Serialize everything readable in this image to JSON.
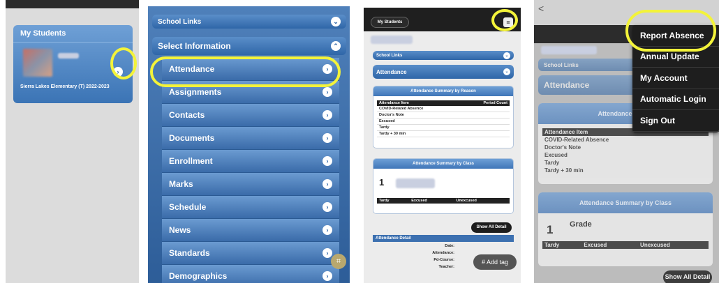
{
  "panel1": {
    "card_title": "My Students",
    "school": "Sierra Lakes Elementary (T) 2022-2023"
  },
  "panel2": {
    "school_links": "School Links",
    "select_information": "Select Information",
    "menu": [
      "Attendance",
      "Assignments",
      "Contacts",
      "Documents",
      "Enrollment",
      "Marks",
      "Schedule",
      "News",
      "Standards",
      "Demographics"
    ]
  },
  "panel3": {
    "my_students": "My Students",
    "school_links": "School Links",
    "attendance": "Attendance",
    "summary_by_reason": {
      "title": "Attendance Summary by Reason",
      "headers": [
        "Attendance Item",
        "Period Count"
      ],
      "rows": [
        "COVID-Related Absence",
        "Doctor's Note",
        "Excused",
        "Tardy",
        "Tardy + 30 min"
      ]
    },
    "summary_by_class": {
      "title": "Attendance Summary by Class",
      "period": "1",
      "headers": [
        "Tardy",
        "Excused",
        "Unexcused"
      ]
    },
    "show_all_detail": "Show All Detail",
    "attendance_detail": "Attendance Detail",
    "detail_labels": [
      "Date:",
      "Attendance:",
      "Pd-Course:",
      "Teacher:"
    ],
    "add_tag": "# Add tag"
  },
  "panel4": {
    "back_glyph": "<",
    "school_links": "School Links",
    "attendance": "Attendance",
    "summary_title_partial": "Attendance Summ",
    "table_header": "Attendance Item",
    "rows": [
      "COVID-Related Absence",
      "Doctor's Note",
      "Excused",
      "Tardy",
      "Tardy + 30 min"
    ],
    "class_title": "Attendance Summary by Class",
    "period": "1",
    "grade": "Grade",
    "class_headers": [
      "Tardy",
      "Excused",
      "Unexcused"
    ],
    "show_all_detail": "Show All Detail",
    "dropdown": [
      "Report Absence",
      "Annual Update",
      "My Account",
      "Automatic Login",
      "Sign Out"
    ]
  },
  "colors": {
    "accent_blue": "#3b74b5",
    "highlight_yellow": "#f3f33a",
    "dark_bar": "#1f1f1f"
  }
}
